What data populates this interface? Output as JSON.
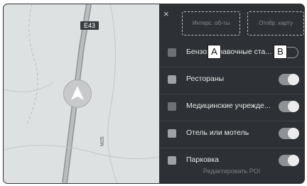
{
  "map": {
    "road_badge": "E43",
    "road_label": "M25"
  },
  "panel": {
    "close_symbol": "×",
    "btn_poi": "Интерс. об-ты",
    "btn_map": "Отобр. карту",
    "items": [
      {
        "label": "Бензозаправочные ста...",
        "icon": "fuel-icon",
        "enabled": false
      },
      {
        "label": "Рестораны",
        "icon": "restaurant-icon",
        "enabled": true
      },
      {
        "label": "Медицинские учрежде...",
        "icon": "medical-icon",
        "enabled": true
      },
      {
        "label": "Отель или мотель",
        "icon": "hotel-icon",
        "enabled": true
      },
      {
        "label": "Парковка",
        "icon": "parking-icon",
        "enabled": true
      }
    ],
    "edit_poi": "Редактировать POI"
  },
  "callouts": {
    "a": "A",
    "b": "B"
  }
}
